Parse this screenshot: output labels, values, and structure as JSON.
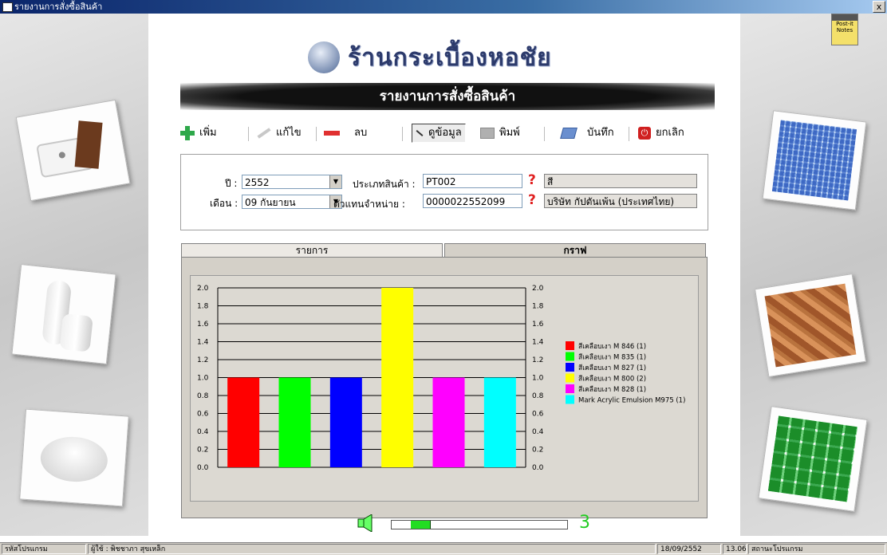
{
  "window": {
    "title": "รายงานการสั่งซื้อสินค้า",
    "close_label": "x"
  },
  "header": {
    "shop_name": "ร้านกระเบื้องหอชัย",
    "report_title": "รายงานการสั่งซื้อสินค้า"
  },
  "toolbar": {
    "add_label": "เพิ่ม",
    "edit_label": "แก้ไข",
    "delete_label": "ลบ",
    "view_label": "ดูข้อมูล",
    "print_label": "พิมพ์",
    "save_label": "บันทึก",
    "cancel_label": "ยกเลิก"
  },
  "filters": {
    "year_label": "ปี :",
    "year_value": "2552",
    "month_label": "เดือน :",
    "month_value": "09 กันยายน",
    "product_type_label": "ประเภทสินค้า :",
    "product_type_value": "PT002",
    "product_type_name": "สี",
    "dealer_label": "ตัวแทนจำหน่าย :",
    "dealer_value": "0000022552099",
    "dealer_name": "บริษัท กัปตันเพ้น (ประเทศไทย)"
  },
  "tabs": {
    "list_label": "รายการ",
    "graph_label": "กราฟ"
  },
  "chart_data": {
    "type": "bar",
    "categories": [
      "สีเคลือบเงา M 846 (1)",
      "สีเคลือบเงา M 835 (1)",
      "สีเคลือบเงา M 827 (1)",
      "สีเคลือบเงา M 800 (2)",
      "สีเคลือบเงา M 828 (1)",
      "Mark Acrylic Emulsion M975 (1)"
    ],
    "values": [
      1,
      1,
      1,
      2,
      1,
      1
    ],
    "colors": [
      "#ff0000",
      "#00ff00",
      "#0000ff",
      "#ffff00",
      "#ff00ff",
      "#00ffff"
    ],
    "ylim": [
      0,
      2.0
    ],
    "yticks": [
      "0.0",
      "0.2",
      "0.4",
      "0.6",
      "0.8",
      "1.0",
      "1.2",
      "1.4",
      "1.6",
      "1.8",
      "2.0"
    ],
    "grid": true,
    "legend": "right"
  },
  "chart_controls": {
    "depth_value": "3",
    "slider_fraction": 0.12
  },
  "statusbar": {
    "program_code": "รหัสโปรแกรม",
    "user": "ผู้ใช้ : พิชชาภา สุขเหล็ก",
    "date": "18/09/2552",
    "time": "13.06",
    "program_status": "สถานะโปรแกรม"
  }
}
